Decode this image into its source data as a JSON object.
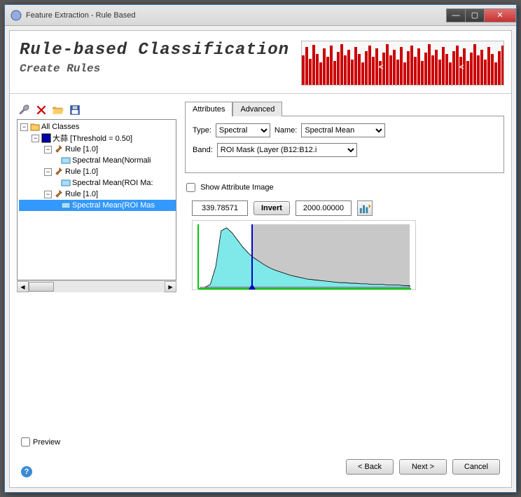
{
  "window": {
    "title": "Feature Extraction - Rule Based"
  },
  "header": {
    "title": "Rule-based Classification",
    "subtitle": "Create Rules"
  },
  "tree": {
    "root": "All Classes",
    "class_label": "大蒜 [Threshold = 0.50]",
    "rules": [
      {
        "label": "Rule [1.0]",
        "attr": "Spectral Mean(Normali"
      },
      {
        "label": "Rule [1.0]",
        "attr": "Spectral Mean(ROI Ma:"
      },
      {
        "label": "Rule [1.0]",
        "attr": "Spectral Mean(ROI Mas"
      }
    ]
  },
  "tabs": {
    "attributes": "Attributes",
    "advanced": "Advanced"
  },
  "form": {
    "type_label": "Type:",
    "type_value": "Spectral",
    "name_label": "Name:",
    "name_value": "Spectral Mean",
    "band_label": "Band:",
    "band_value": "ROI Mask (Layer (B12:B12.i",
    "show_attr": "Show Attribute Image",
    "val_low": "339.78571",
    "invert": "Invert",
    "val_high": "2000.00000"
  },
  "footer": {
    "preview": "Preview",
    "back": "< Back",
    "next": "Next >",
    "cancel": "Cancel"
  },
  "chart_data": {
    "type": "area",
    "title": "",
    "xlabel": "",
    "ylabel": "",
    "x_range": [
      0,
      8000
    ],
    "selection": [
      339.78571,
      2000.0
    ],
    "values": [
      0,
      0,
      5,
      35,
      95,
      100,
      92,
      80,
      68,
      58,
      50,
      44,
      38,
      33,
      29,
      26,
      23,
      20,
      18,
      16,
      14,
      13,
      12,
      11,
      10,
      9,
      8,
      8,
      7,
      7,
      6,
      6,
      5,
      5,
      5,
      4,
      4,
      4,
      3,
      3
    ]
  }
}
